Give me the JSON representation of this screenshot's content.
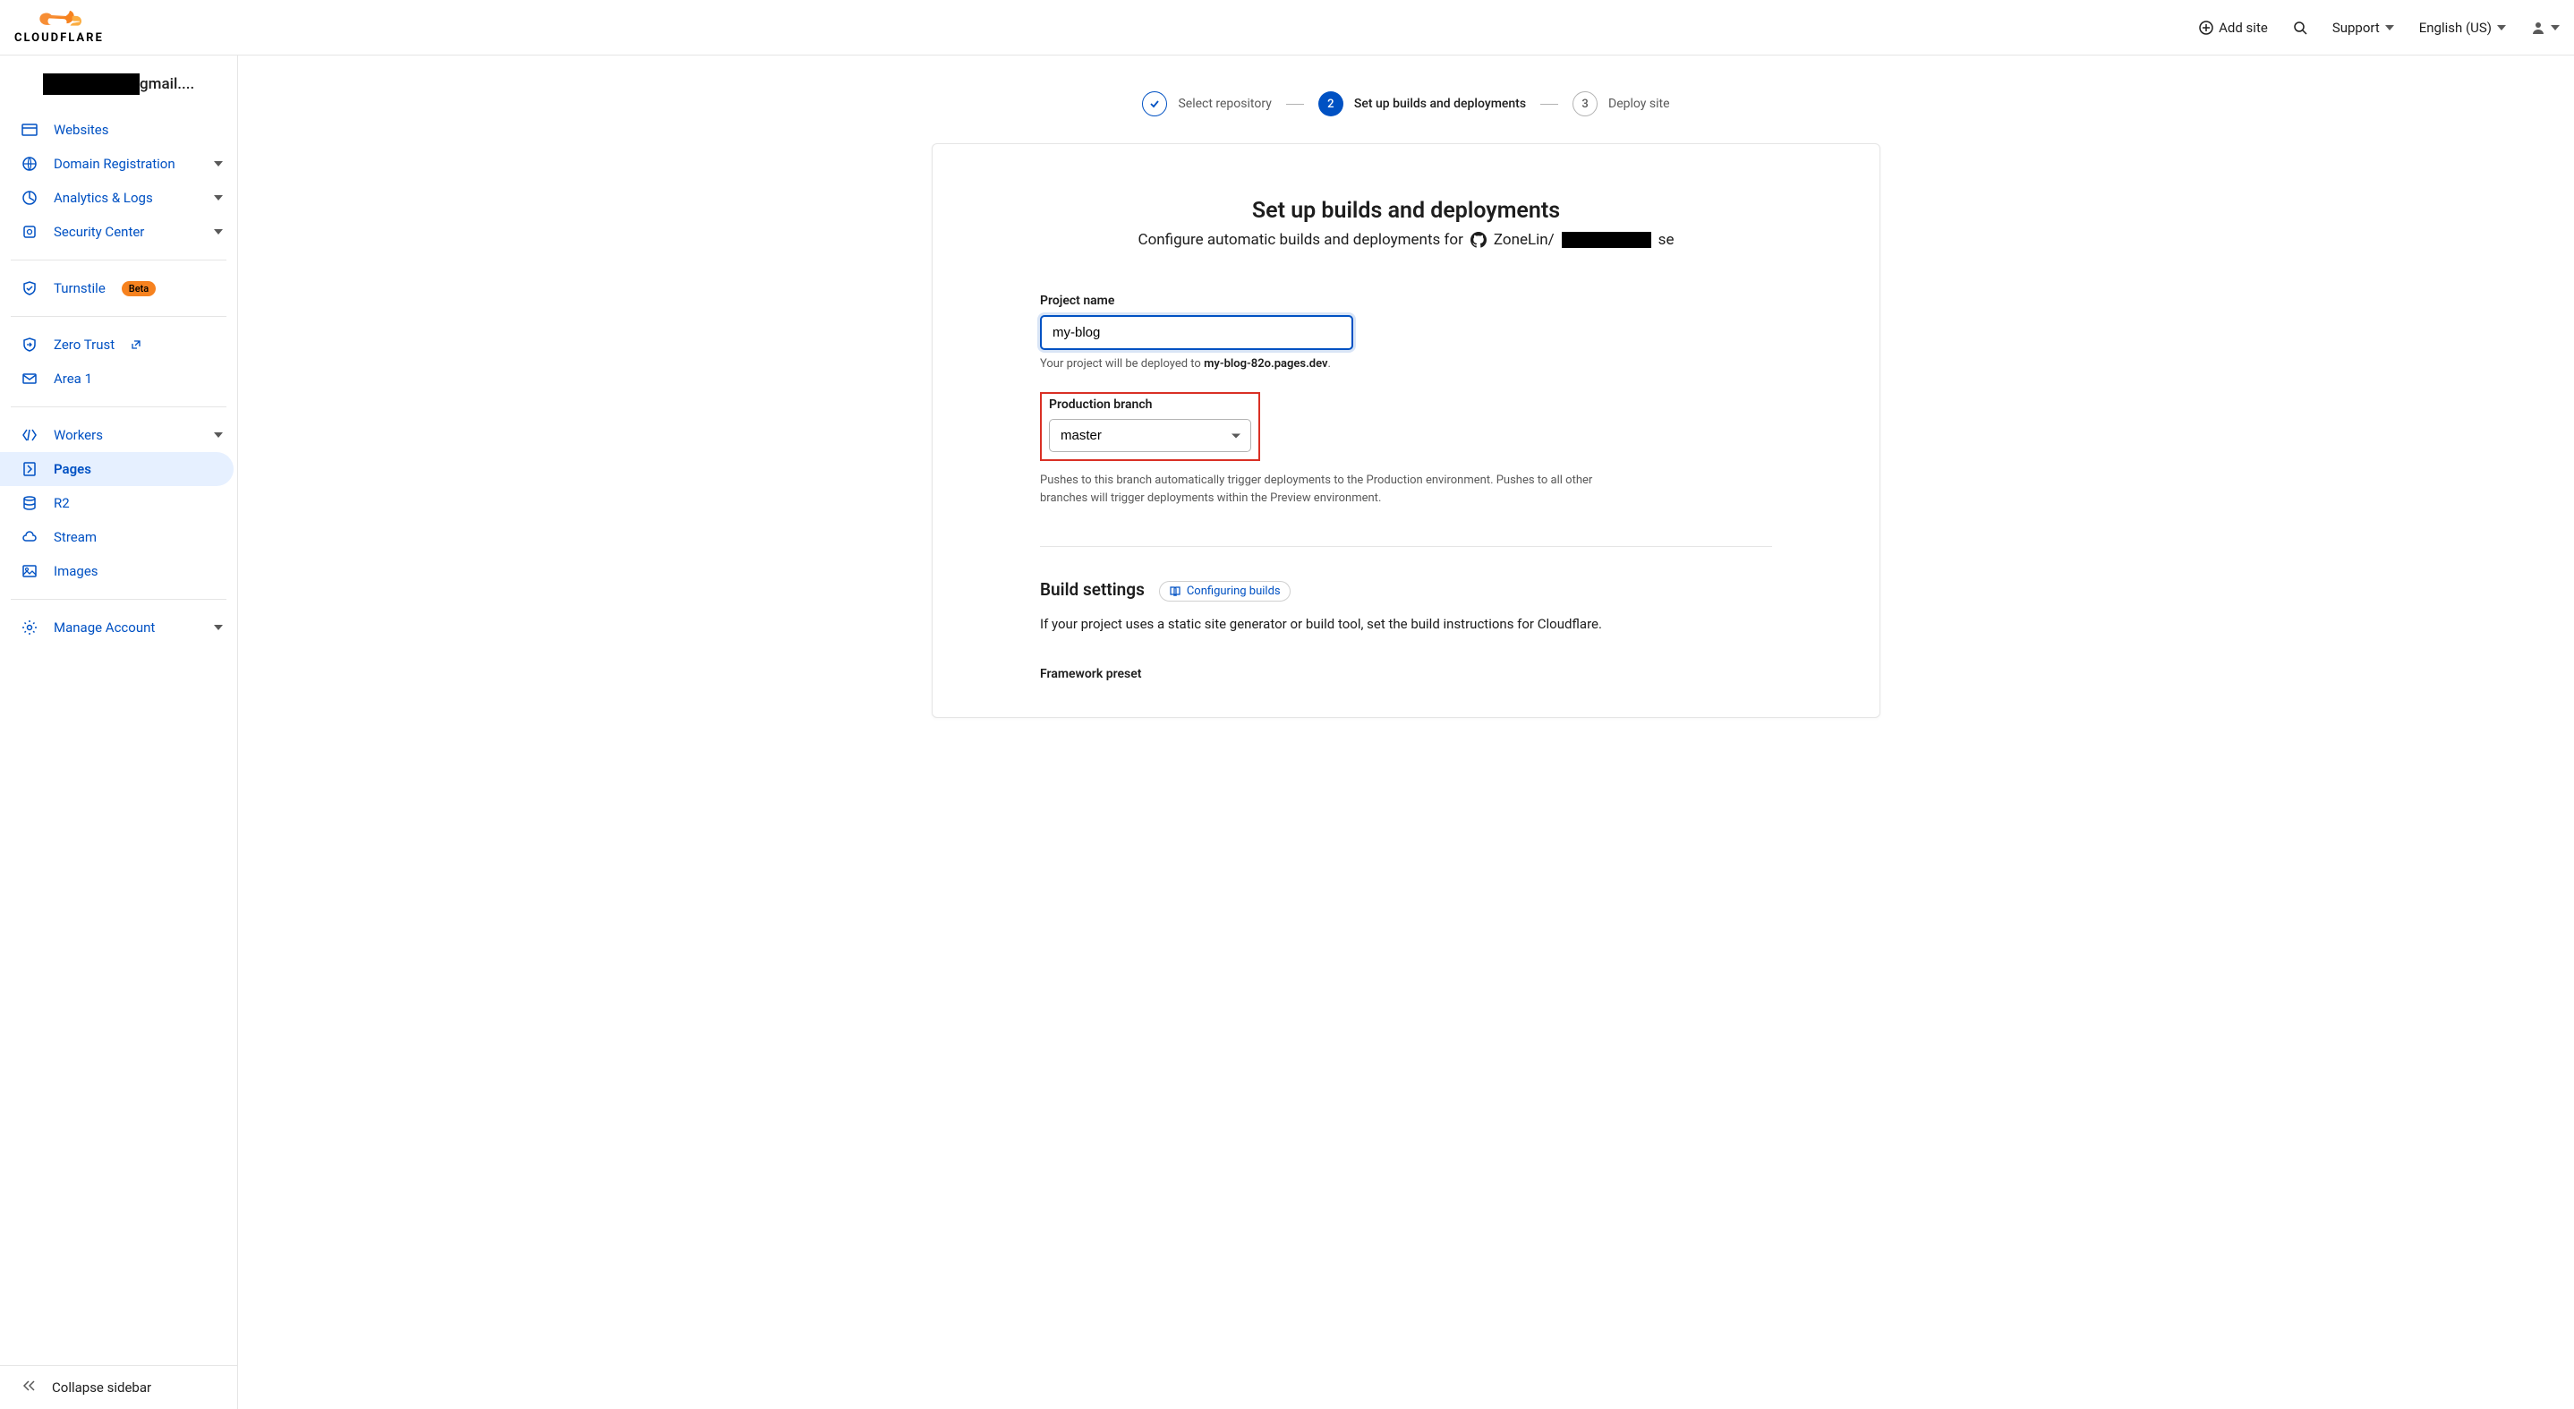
{
  "header": {
    "logo_text": "CLOUDFLARE",
    "add_site": "Add site",
    "support": "Support",
    "language": "English (US)"
  },
  "sidebar": {
    "account_suffix": "gmail....",
    "items": {
      "websites": "Websites",
      "domain_registration": "Domain Registration",
      "analytics_logs": "Analytics & Logs",
      "security_center": "Security Center",
      "turnstile": "Turnstile",
      "turnstile_badge": "Beta",
      "zero_trust": "Zero Trust",
      "area_1": "Area 1",
      "workers": "Workers",
      "pages": "Pages",
      "r2": "R2",
      "stream": "Stream",
      "images": "Images",
      "manage_account": "Manage Account"
    },
    "collapse": "Collapse sidebar"
  },
  "stepper": {
    "step1": "Select repository",
    "step2_num": "2",
    "step2": "Set up builds and deployments",
    "step3_num": "3",
    "step3": "Deploy site"
  },
  "form": {
    "title": "Set up builds and deployments",
    "subtitle_prefix": "Configure automatic builds and deployments for",
    "repo_prefix": "ZoneLin/",
    "repo_suffix": "se",
    "project_name_label": "Project name",
    "project_name_value": "my-blog",
    "project_help_prefix": "Your project will be deployed to ",
    "project_help_domain": "my-blog-82o.pages.dev",
    "branch_label": "Production branch",
    "branch_value": "master",
    "branch_help": "Pushes to this branch automatically trigger deployments to the Production environment. Pushes to all other branches will trigger deployments within the Preview environment.",
    "build_settings": "Build settings",
    "configuring_builds": "Configuring builds",
    "build_desc": "If your project uses a static site generator or build tool, set the build instructions for Cloudflare.",
    "framework_label": "Framework preset"
  }
}
